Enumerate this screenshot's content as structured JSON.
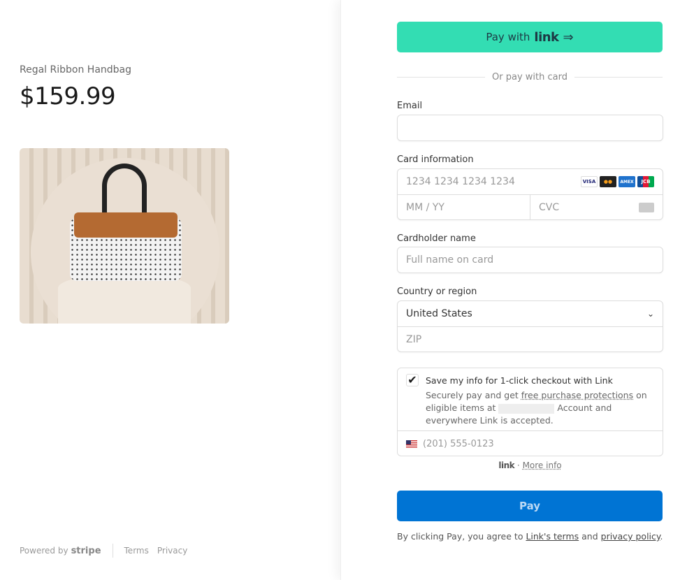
{
  "product": {
    "name": "Regal Ribbon Handbag",
    "price": "$159.99"
  },
  "footer": {
    "powered": "Powered by",
    "brand": "stripe",
    "terms": "Terms",
    "privacy": "Privacy"
  },
  "checkout": {
    "pay_link_prefix": "Pay with",
    "pay_link_brand": "link",
    "pay_link_arrow": "⇒",
    "or_text": "Or pay with card",
    "email_label": "Email",
    "email_value": "",
    "card_label": "Card information",
    "card_number_placeholder": "1234 1234 1234 1234",
    "expiry_placeholder": "MM / YY",
    "cvc_placeholder": "CVC",
    "card_brands": [
      "VISA",
      "MC",
      "AMEX",
      "JCB"
    ],
    "name_label": "Cardholder name",
    "name_placeholder": "Full name on card",
    "country_label": "Country or region",
    "country_value": "United States",
    "zip_placeholder": "ZIP",
    "save_title": "Save my info for 1-click checkout with Link",
    "save_desc_1": "Securely pay and get ",
    "save_desc_link": "free purchase protections",
    "save_desc_2": " on eligible items at ",
    "save_desc_3": " Account and everywhere Link is accepted.",
    "save_checked": true,
    "phone_placeholder": "(201) 555-0123",
    "link_brand": "link",
    "more_info": "More info",
    "pay_button": "Pay",
    "terms_1": "By clicking Pay, you agree to ",
    "terms_link1": "Link's terms",
    "terms_2": " and ",
    "terms_link2": "privacy policy",
    "terms_3": "."
  },
  "colors": {
    "link_button": "#33ddb3",
    "pay_button": "#0074d4"
  }
}
